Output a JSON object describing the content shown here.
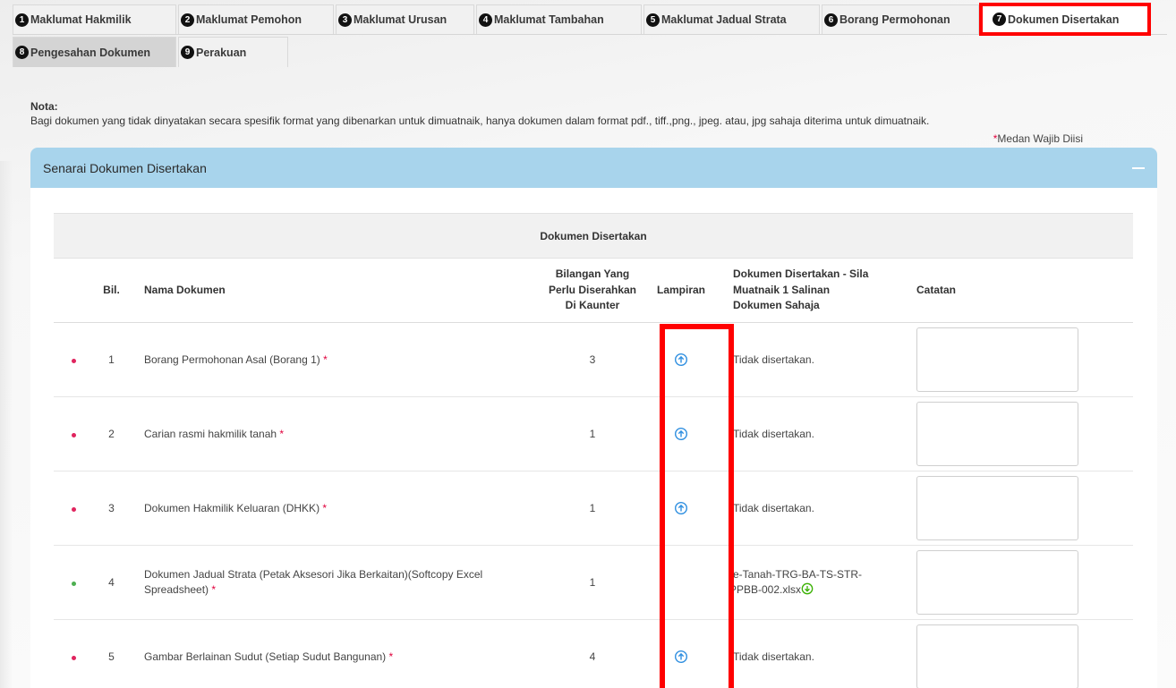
{
  "tabs_row1": [
    {
      "num": "1",
      "label": "Maklumat Hakmilik"
    },
    {
      "num": "2",
      "label": "Maklumat Pemohon"
    },
    {
      "num": "3",
      "label": "Maklumat Urusan"
    },
    {
      "num": "4",
      "label": "Maklumat Tambahan"
    },
    {
      "num": "5",
      "label": "Maklumat Jadual Strata"
    },
    {
      "num": "6",
      "label": "Borang Permohonan"
    },
    {
      "num": "7",
      "label": "Dokumen Disertakan"
    }
  ],
  "tabs_row2": [
    {
      "num": "8",
      "label": "Pengesahan Dokumen"
    },
    {
      "num": "9",
      "label": "Perakuan"
    }
  ],
  "note": {
    "title": "Nota:",
    "text": "Bagi dokumen yang tidak dinyatakan secara spesifik format yang dibenarkan untuk dimuatnaik, hanya dokumen dalam format pdf., tiff.,png., jpeg. atau, jpg sahaja diterima untuk dimuatnaik."
  },
  "required_hint": {
    "star": "*",
    "text": "Medan Wajib Diisi"
  },
  "panel": {
    "title": "Senarai Dokumen Disertakan"
  },
  "table": {
    "caption": "Dokumen Disertakan",
    "headers": {
      "bil": "Bil.",
      "name": "Nama Dokumen",
      "qty_l1": "Bilangan Yang",
      "qty_l2": "Perlu Diserahkan",
      "qty_l3": "Di Kaunter",
      "attach": "Lampiran",
      "doc_l1": "Dokumen Disertakan - Sila",
      "doc_l2": "Muatnaik 1 Salinan",
      "doc_l3": "Dokumen Sahaja",
      "notes": "Catatan"
    },
    "rows": [
      {
        "bil": "1",
        "name": "Borang Permohonan Asal (Borang 1)",
        "star": "*",
        "qty": "3",
        "status": "Tidak disertakan.",
        "file_l1": "",
        "file_l2": ""
      },
      {
        "bil": "2",
        "name": "Carian rasmi hakmilik tanah",
        "star": "*",
        "qty": "1",
        "status": "Tidak disertakan.",
        "file_l1": "",
        "file_l2": ""
      },
      {
        "bil": "3",
        "name": "Dokumen Hakmilik Keluaran (DHKK)",
        "star": "*",
        "qty": "1",
        "status": "Tidak disertakan.",
        "file_l1": "",
        "file_l2": ""
      },
      {
        "bil": "4",
        "name_l1": "Dokumen Jadual Strata (Petak Aksesori Jika Berkaitan)(Softcopy Excel",
        "name_l2": "Spreadsheet)",
        "star": "*",
        "qty": "1",
        "status": "",
        "file_l1": "e-Tanah-TRG-BA-TS-STR-",
        "file_l2": "PPBB-002.xlsx"
      },
      {
        "bil": "5",
        "name": "Gambar Berlainan Sudut (Setiap Sudut Bangunan)",
        "star": "*",
        "qty": "4",
        "status": "Tidak disertakan.",
        "file_l1": "",
        "file_l2": ""
      }
    ]
  },
  "colors": {
    "accent_header": "#a8d4ec",
    "highlight": "#ff0000",
    "required": "#e0003c",
    "icon_blue": "#2f8fe0",
    "icon_green": "#38b000"
  }
}
